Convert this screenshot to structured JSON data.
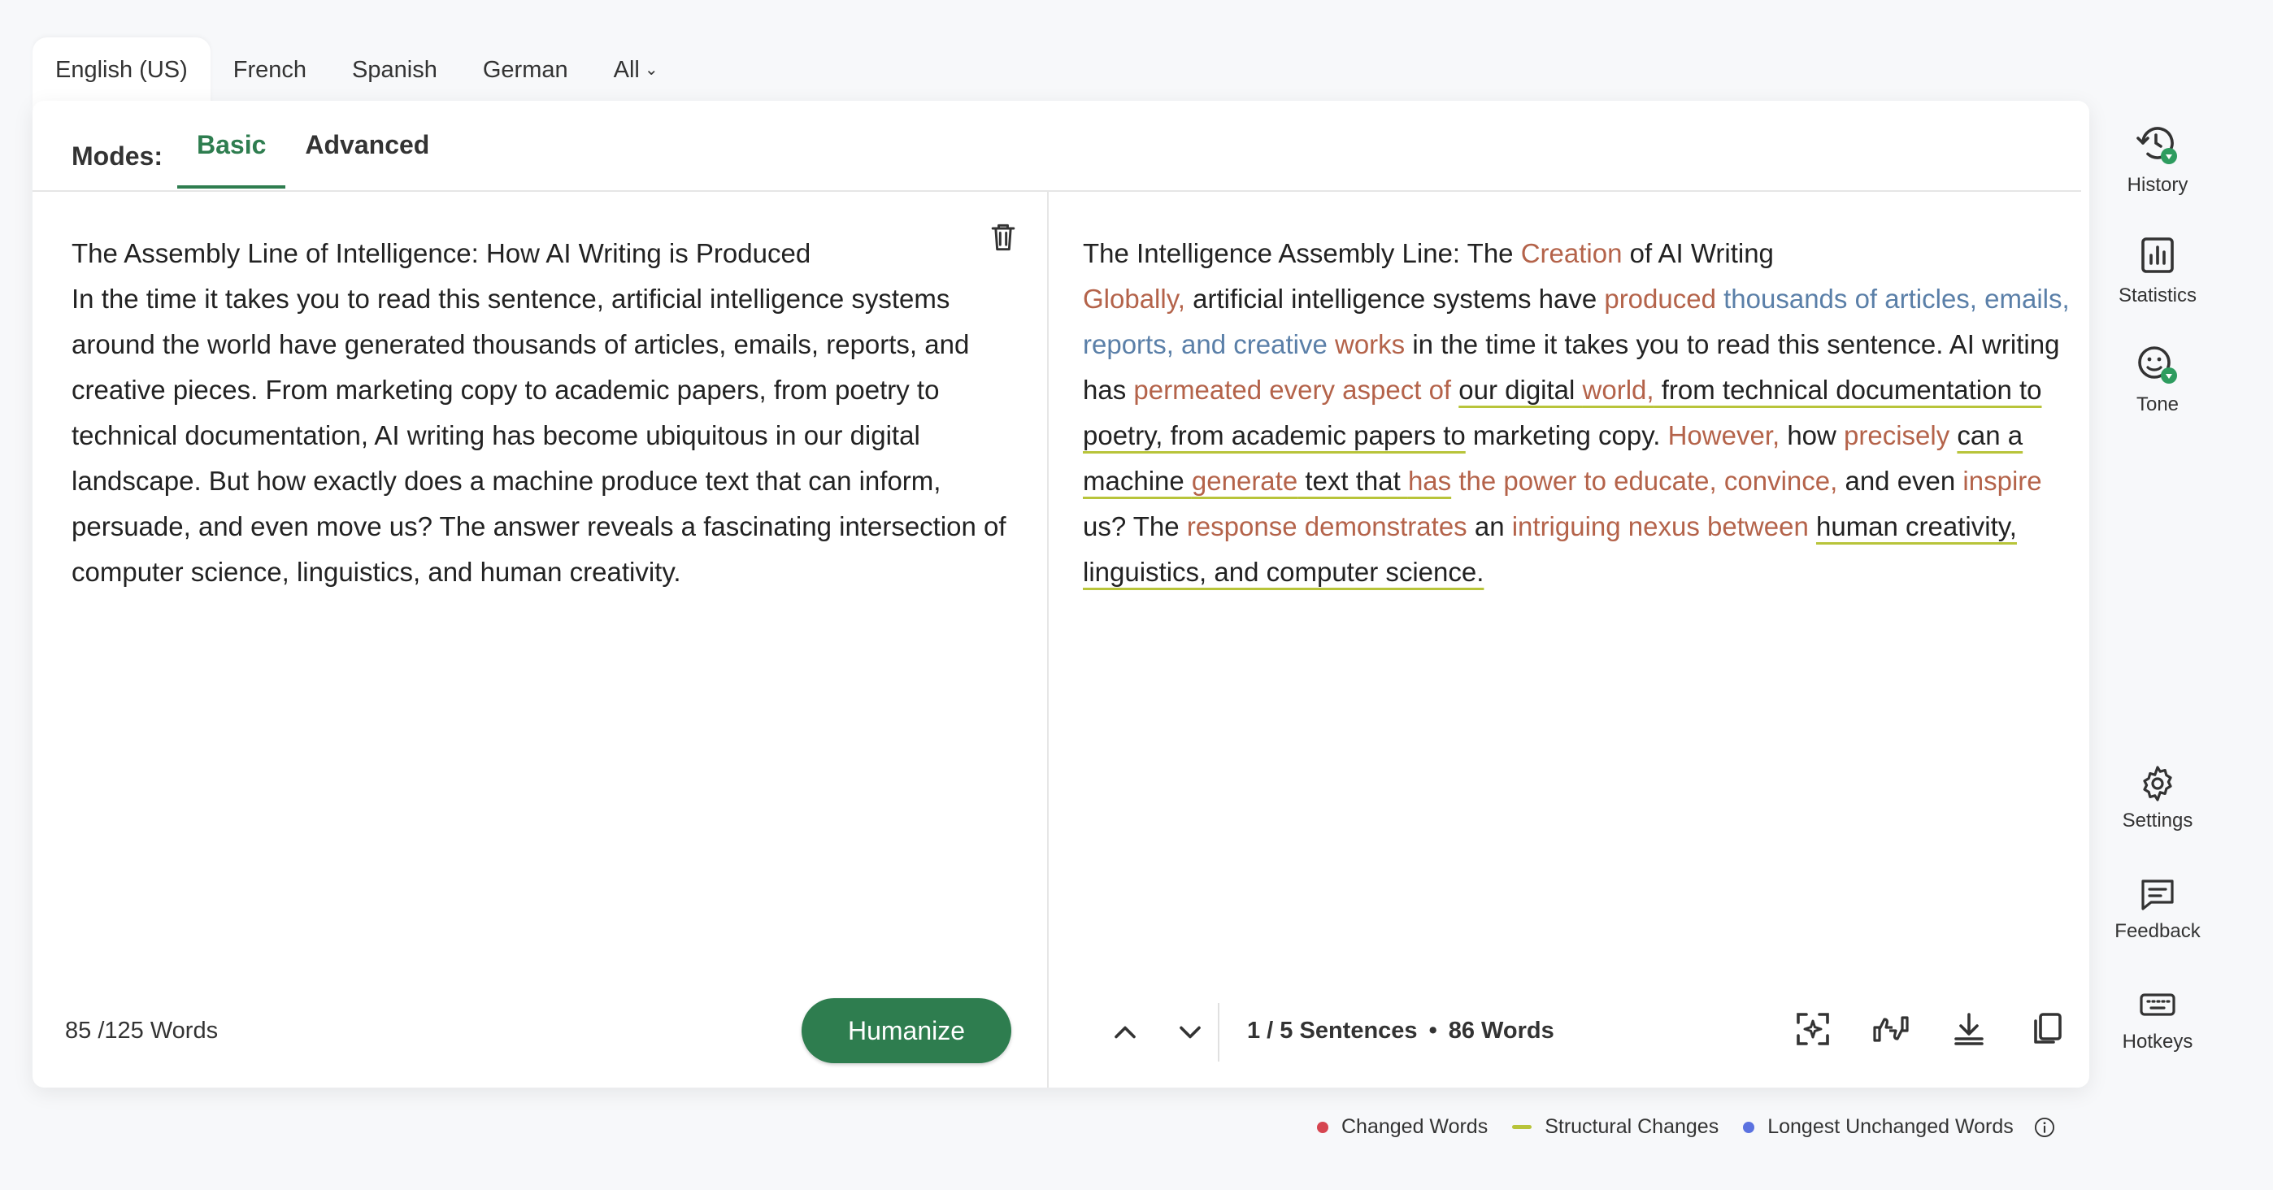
{
  "languages": {
    "tabs": [
      "English (US)",
      "French",
      "Spanish",
      "German",
      "All"
    ],
    "active": "English (US)"
  },
  "modes": {
    "label": "Modes:",
    "tabs": [
      "Basic",
      "Advanced"
    ],
    "active": "Basic"
  },
  "input": {
    "title": "The Assembly Line of Intelligence: How AI Writing is Produced",
    "body": "In the time it takes you to read this sentence, artificial intelligence systems around the world have generated thousands of articles, emails, reports, and creative pieces. From marketing copy to academic papers, from poetry to technical documentation, AI writing has become ubiquitous in our digital landscape. But how exactly does a machine produce text that can inform, persuade, and even move us? The answer reveals a fascinating intersection of computer science, linguistics, and human creativity.",
    "word_count": "85 /125 Words"
  },
  "humanize_label": "Humanize",
  "output": {
    "title": [
      {
        "t": "The Intelligence Assembly Line: The "
      },
      {
        "t": "Creation",
        "s": "ch"
      },
      {
        "t": " of AI Writing"
      }
    ],
    "body": [
      {
        "t": "Globally,",
        "s": "ch"
      },
      {
        "t": " artificial intelligence systems have "
      },
      {
        "t": "produced",
        "s": "ch"
      },
      {
        "t": " thousands of articles, emails, reports, and creative",
        "s": "lu"
      },
      {
        "t": " works",
        "s": "ch"
      },
      {
        "t": " in the time it takes you to read this sentence. AI writing has "
      },
      {
        "t": "permeated every aspect of",
        "s": "ch"
      },
      {
        "t": " "
      },
      {
        "t": "our digital ",
        "s": "st"
      },
      {
        "t": "world,",
        "s": "st ch"
      },
      {
        "t": " from technical documentation to poetry, from academic papers to",
        "s": "st"
      },
      {
        "t": " marketing copy. "
      },
      {
        "t": "However,",
        "s": "ch"
      },
      {
        "t": " how "
      },
      {
        "t": "precisely",
        "s": "ch"
      },
      {
        "t": " "
      },
      {
        "t": "can a machine ",
        "s": "st"
      },
      {
        "t": "generate",
        "s": "st ch"
      },
      {
        "t": " text that ",
        "s": "st"
      },
      {
        "t": "has",
        "s": "st ch"
      },
      {
        "t": " the power to educate, convince,",
        "s": "ch"
      },
      {
        "t": " and even "
      },
      {
        "t": "inspire",
        "s": "ch"
      },
      {
        "t": " us? The "
      },
      {
        "t": "response demonstrates",
        "s": "ch"
      },
      {
        "t": " an "
      },
      {
        "t": "intriguing nexus between",
        "s": "ch"
      },
      {
        "t": " "
      },
      {
        "t": "human creativity, linguistics, and computer science.",
        "s": "st"
      }
    ],
    "sentences": "1 / 5 Sentences",
    "word_count": "86 Words"
  },
  "sidebar": {
    "top": [
      {
        "label": "History",
        "icon": "history-icon"
      },
      {
        "label": "Statistics",
        "icon": "statistics-icon"
      },
      {
        "label": "Tone",
        "icon": "tone-icon"
      }
    ],
    "bottom": [
      {
        "label": "Settings",
        "icon": "gear-icon"
      },
      {
        "label": "Feedback",
        "icon": "feedback-icon"
      },
      {
        "label": "Hotkeys",
        "icon": "keyboard-icon"
      }
    ]
  },
  "legend": {
    "changed": "Changed Words",
    "structural": "Structural Changes",
    "unchanged": "Longest Unchanged Words"
  },
  "colors": {
    "brand": "#2e7d4f",
    "changed": "#d64550",
    "structural": "#b8c43a",
    "unchanged": "#5b72e0"
  }
}
